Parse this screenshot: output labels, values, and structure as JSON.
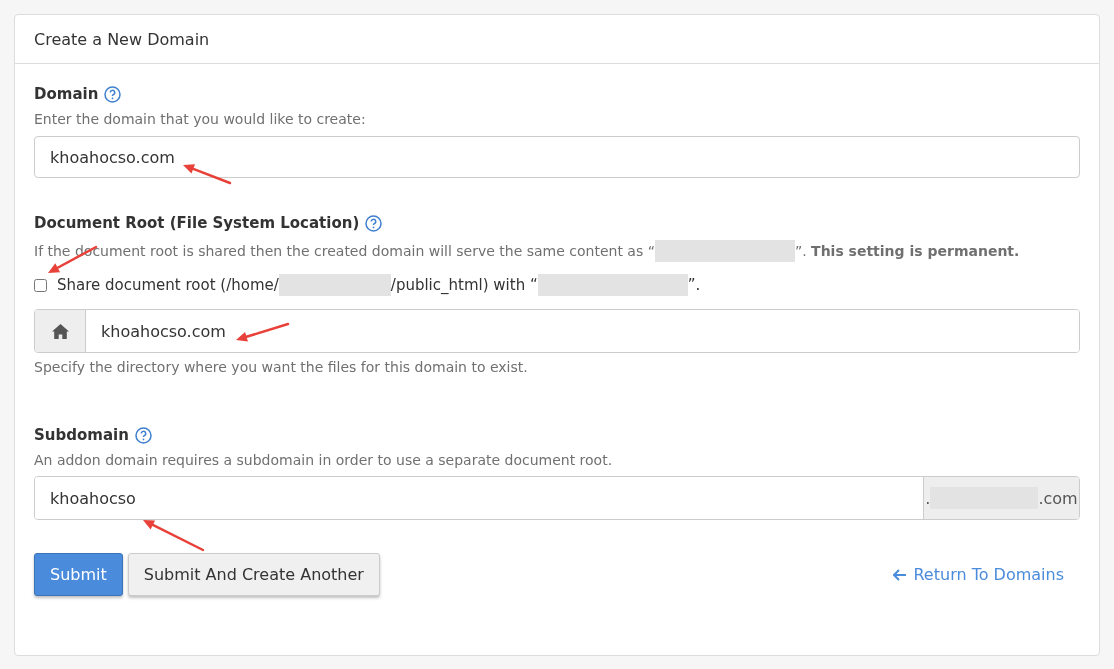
{
  "panel": {
    "title": "Create a New Domain"
  },
  "domain": {
    "label": "Domain",
    "help": "Enter the domain that you would like to create:",
    "value": "khoahocso.com"
  },
  "document_root": {
    "label": "Document Root (File System Location)",
    "notice_before": "If the document root is shared then the created domain will serve the same content as “",
    "notice_after": "”. **This setting is permanent.**",
    "share": {
      "checked": false,
      "before": "Share document root (/home/",
      "middle": "/public_html) with “",
      "after": "”."
    },
    "value": "khoahocso.com",
    "help": "Specify the directory where you want the files for this domain to exist."
  },
  "subdomain": {
    "label": "Subdomain",
    "help": "An addon domain requires a subdomain in order to use a separate document root.",
    "value": "khoahocso",
    "suffix_before": ".",
    "suffix_after": ".com"
  },
  "buttons": [
    {
      "label": "Submit",
      "kind": "primary"
    },
    {
      "label": "Submit And Create Another",
      "kind": "default"
    }
  ],
  "return_link": "Return To Domains"
}
